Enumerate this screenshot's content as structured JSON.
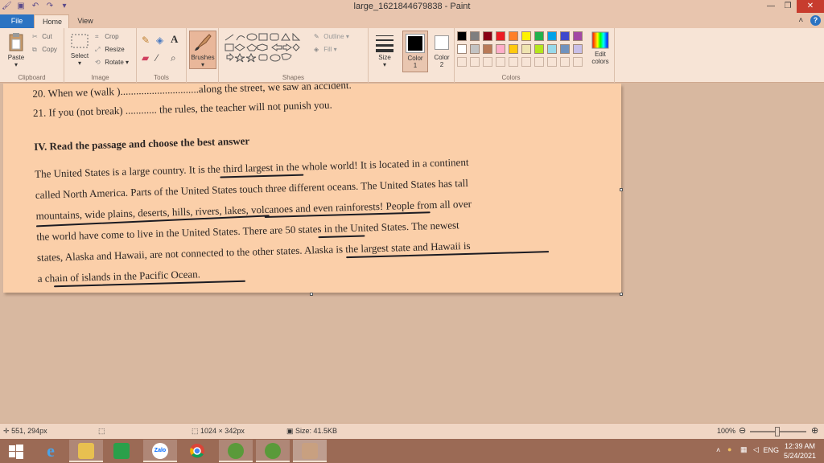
{
  "window": {
    "title": "large_1621844679838 - Paint",
    "min_glyph": "—",
    "max_glyph": "❐",
    "close_glyph": "✕",
    "caret_glyph": "˄",
    "help_glyph": "?"
  },
  "tabs": {
    "file": "File",
    "home": "Home",
    "view": "View"
  },
  "ribbon": {
    "clipboard": {
      "label": "Clipboard",
      "paste": "Paste",
      "cut": "Cut",
      "copy": "Copy"
    },
    "image": {
      "label": "Image",
      "select": "Select",
      "crop": "Crop",
      "resize": "Resize",
      "rotate": "Rotate"
    },
    "tools": {
      "label": "Tools"
    },
    "brushes": {
      "label": "Brushes"
    },
    "shapes": {
      "label": "Shapes",
      "outline": "Outline",
      "fill": "Fill"
    },
    "size": {
      "label": "Size"
    },
    "color1": {
      "label": "Color",
      "num": "1"
    },
    "color2": {
      "label": "Color",
      "num": "2"
    },
    "colors": {
      "label": "Colors",
      "edit_line1": "Edit",
      "edit_line2": "colors"
    },
    "palette_row1": [
      "#000000",
      "#7f7f7f",
      "#880015",
      "#ed1c24",
      "#ff7f27",
      "#fff200",
      "#22b14c",
      "#00a2e8",
      "#3f48cc",
      "#a349a4"
    ],
    "palette_row2": [
      "#ffffff",
      "#c3c3c3",
      "#b97a57",
      "#ffaec9",
      "#ffc90e",
      "#efe4b0",
      "#b5e61d",
      "#99d9ea",
      "#7092be",
      "#c8bfe7"
    ]
  },
  "document": {
    "line_20": "20. When we (walk )..............................along the street, we saw an accident.",
    "line_21": "21. If you (not break)  ............ the rules, the teacher will not punish  you.",
    "heading": "IV. Read the passage and choose the best answer",
    "p1": "The United States is a large country. It is the third largest in the whole world! It is located in a continent",
    "p2": "called North America. Parts of the United States touch three different oceans. The United States has tall",
    "p3": "mountains, wide plains, deserts, hills, rivers, lakes, volcanoes and even rainforests! People from all over",
    "p4": "the world have come to live in the United States. There are 50 states in the United States. The newest",
    "p5": "states, Alaska and Hawaii, are not connected to the other states. Alaska is the largest state and Hawaii is",
    "p6": "a chain of islands in the Pacific Ocean."
  },
  "status": {
    "cursor_pos": "551, 294px",
    "selection_size": "",
    "image_size": "1024 × 342px",
    "file_size": "Size: 41.5KB",
    "zoom": "100%"
  },
  "taskbar": {
    "apps": [
      "start-button",
      "internet-explorer",
      "file-explorer",
      "store",
      "zalo",
      "chrome",
      "app-green-1",
      "app-green-2",
      "paint"
    ],
    "zalo_label": "Zalo",
    "lang": "ENG",
    "time": "12:39 AM",
    "date": "5/24/2021"
  }
}
